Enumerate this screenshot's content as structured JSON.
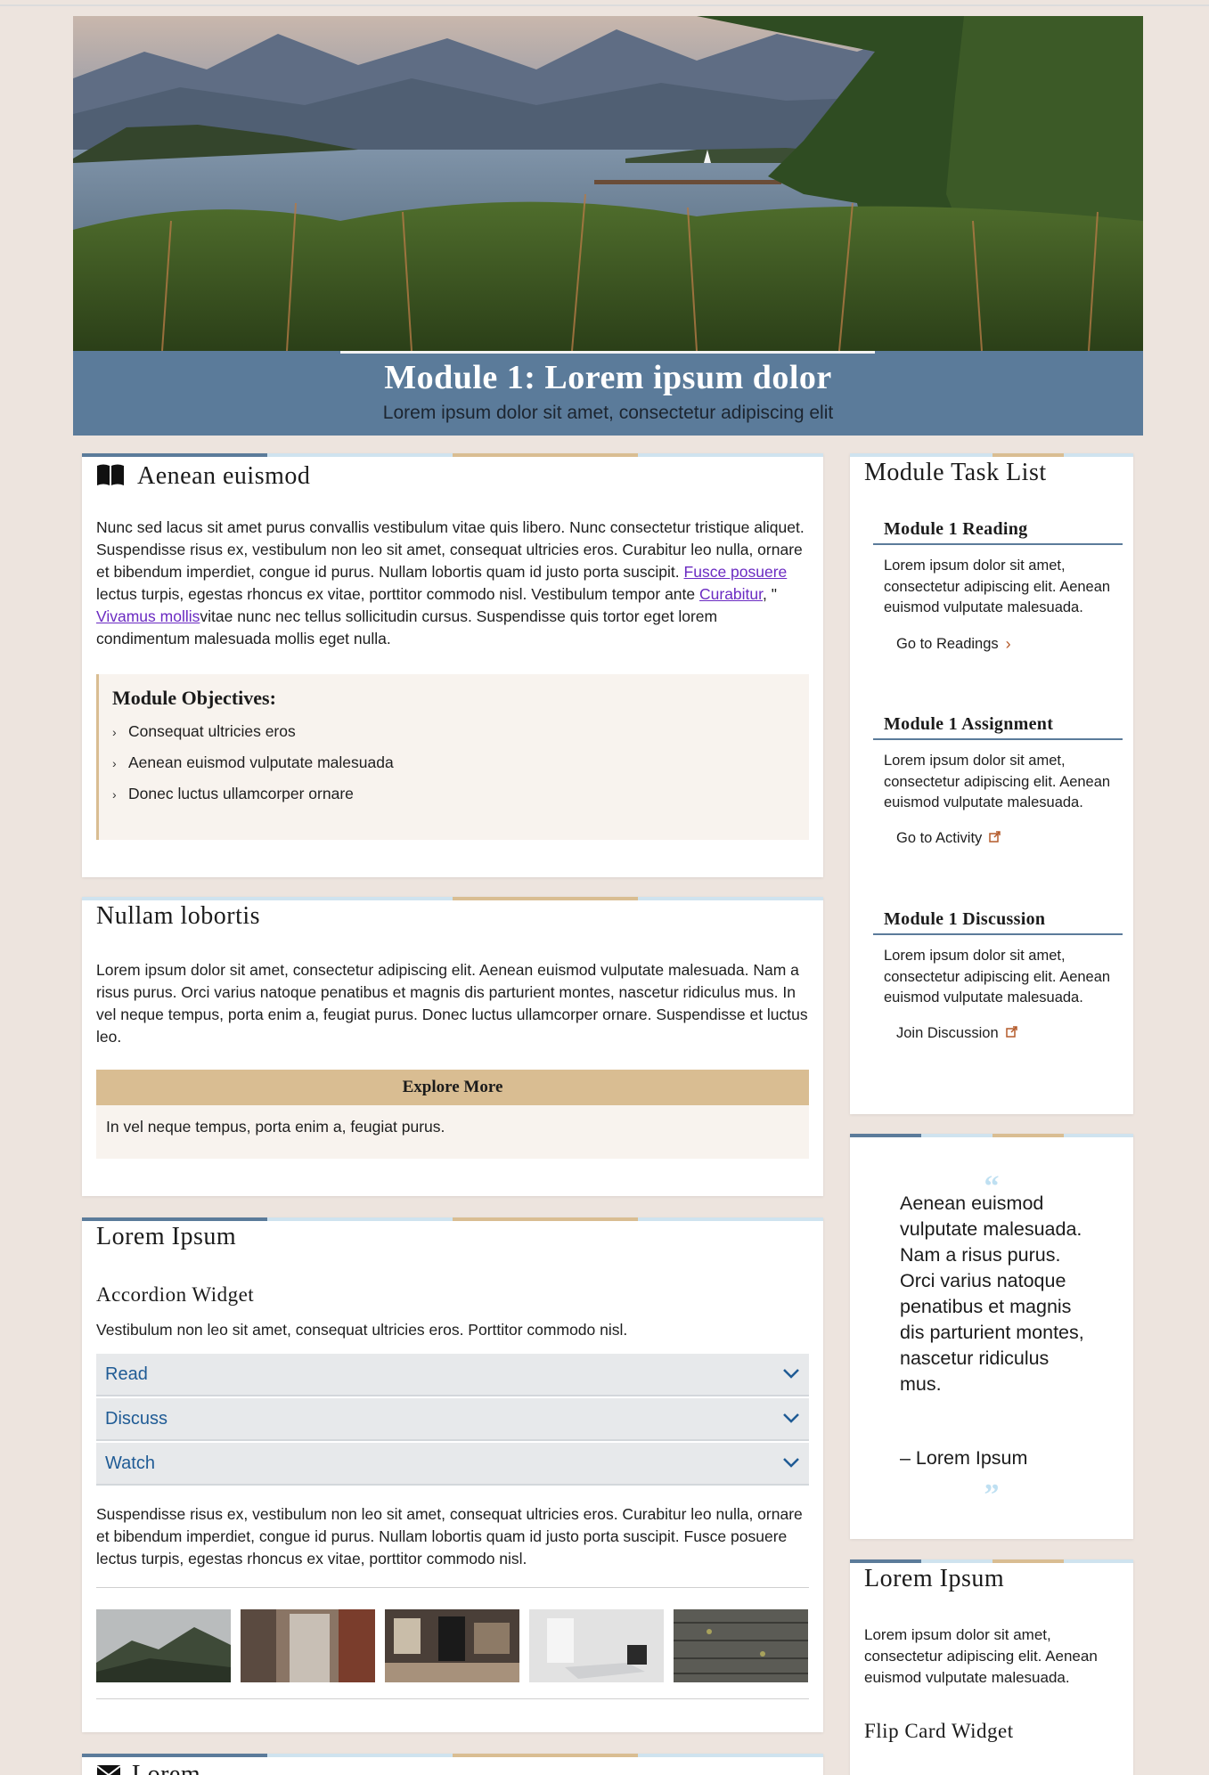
{
  "module": {
    "title": "Module 1: Lorem ipsum dolor",
    "subtitle": "Lorem ipsum dolor sit amet, consectetur adipiscing elit"
  },
  "section1": {
    "icon": "book-icon",
    "heading": "Aenean euismod",
    "p_start": "Nunc sed lacus sit amet purus convallis vestibulum vitae quis libero. Nunc consectetur tristique aliquet. Suspendisse risus ex, vestibulum non leo sit amet, consequat ultricies eros. Curabitur leo nulla, ornare et bibendum imperdiet, congue id purus. Nullam lobortis quam id justo porta suscipit. ",
    "link1": "Fusce posuere",
    "p_mid1": " lectus turpis, egestas rhoncus ex vitae, porttitor commodo nisl. Vestibulum tempor ante ",
    "link2": "Curabitur",
    "p_mid2": ", \" ",
    "link3": "Vivamus mollis",
    "p_end": "vitae nunc nec tellus sollicitudin cursus. Suspendisse quis tortor eget lorem condimentum malesuada mollis eget nulla.",
    "objectives_title": "Module Objectives:",
    "objectives": [
      "Consequat ultricies eros",
      "Aenean euismod vulputate malesuada",
      "Donec luctus ullamcorper ornare"
    ]
  },
  "section2": {
    "heading": "Nullam lobortis",
    "text": "Lorem ipsum dolor sit amet, consectetur adipiscing elit. Aenean euismod vulputate malesuada. Nam a risus purus. Orci varius natoque penatibus et magnis dis parturient montes, nascetur ridiculus mus. In vel neque tempus, porta enim a, feugiat purus. Donec luctus ullamcorper ornare. Suspendisse et luctus leo.",
    "explore_title": "Explore More",
    "explore_text": "In vel neque tempus, porta enim a, feugiat purus."
  },
  "section3": {
    "heading": "Lorem Ipsum",
    "subheading": "Accordion Widget",
    "intro": "Vestibulum non leo sit amet, consequat ultricies eros. Porttitor commodo nisl.",
    "accordion": [
      "Read",
      "Discuss",
      "Watch"
    ],
    "outro": "Suspendisse risus ex, vestibulum non leo sit amet, consequat ultricies eros. Curabitur leo nulla, ornare et bibendum imperdiet, congue id purus. Nullam lobortis quam id justo porta suscipit. Fusce posuere lectus turpis, egestas rhoncus ex vitae, porttitor commodo nisl."
  },
  "section4": {
    "icon": "envelope-icon",
    "heading": "Lorem"
  },
  "tasks": {
    "heading": "Module Task List",
    "items": [
      {
        "title": "Module 1 Reading",
        "text": "Lorem ipsum dolor sit amet, consectetur adipiscing elit. Aenean euismod vulputate malesuada.",
        "link": "Go to Readings",
        "icon": "chevron-right-icon"
      },
      {
        "title": "Module 1 Assignment",
        "text": "Lorem ipsum dolor sit amet, consectetur adipiscing elit. Aenean euismod vulputate malesuada.",
        "link": "Go to Activity",
        "icon": "external-link-icon"
      },
      {
        "title": "Module 1 Discussion",
        "text": "Lorem ipsum dolor sit amet, consectetur adipiscing elit. Aenean euismod vulputate malesuada.",
        "link": "Join Discussion",
        "icon": "external-link-icon"
      }
    ]
  },
  "quote": {
    "text": "Aenean euismod vulputate malesuada. Nam a risus purus. Orci varius natoque penatibus et magnis dis parturient montes, nascetur ridiculus mus.",
    "author": "– Lorem Ipsum"
  },
  "sidebar_card": {
    "heading": "Lorem Ipsum",
    "text": "Lorem ipsum dolor sit amet, consectetur adipiscing elit. Aenean euismod vulputate malesuada.",
    "subheading": "Flip Card Widget"
  },
  "colors": {
    "accent_blue": "#5b7b9a",
    "accent_tan": "#d9bd92",
    "link_purple": "#6b2bc2",
    "accordion_blue": "#1f5b95"
  }
}
